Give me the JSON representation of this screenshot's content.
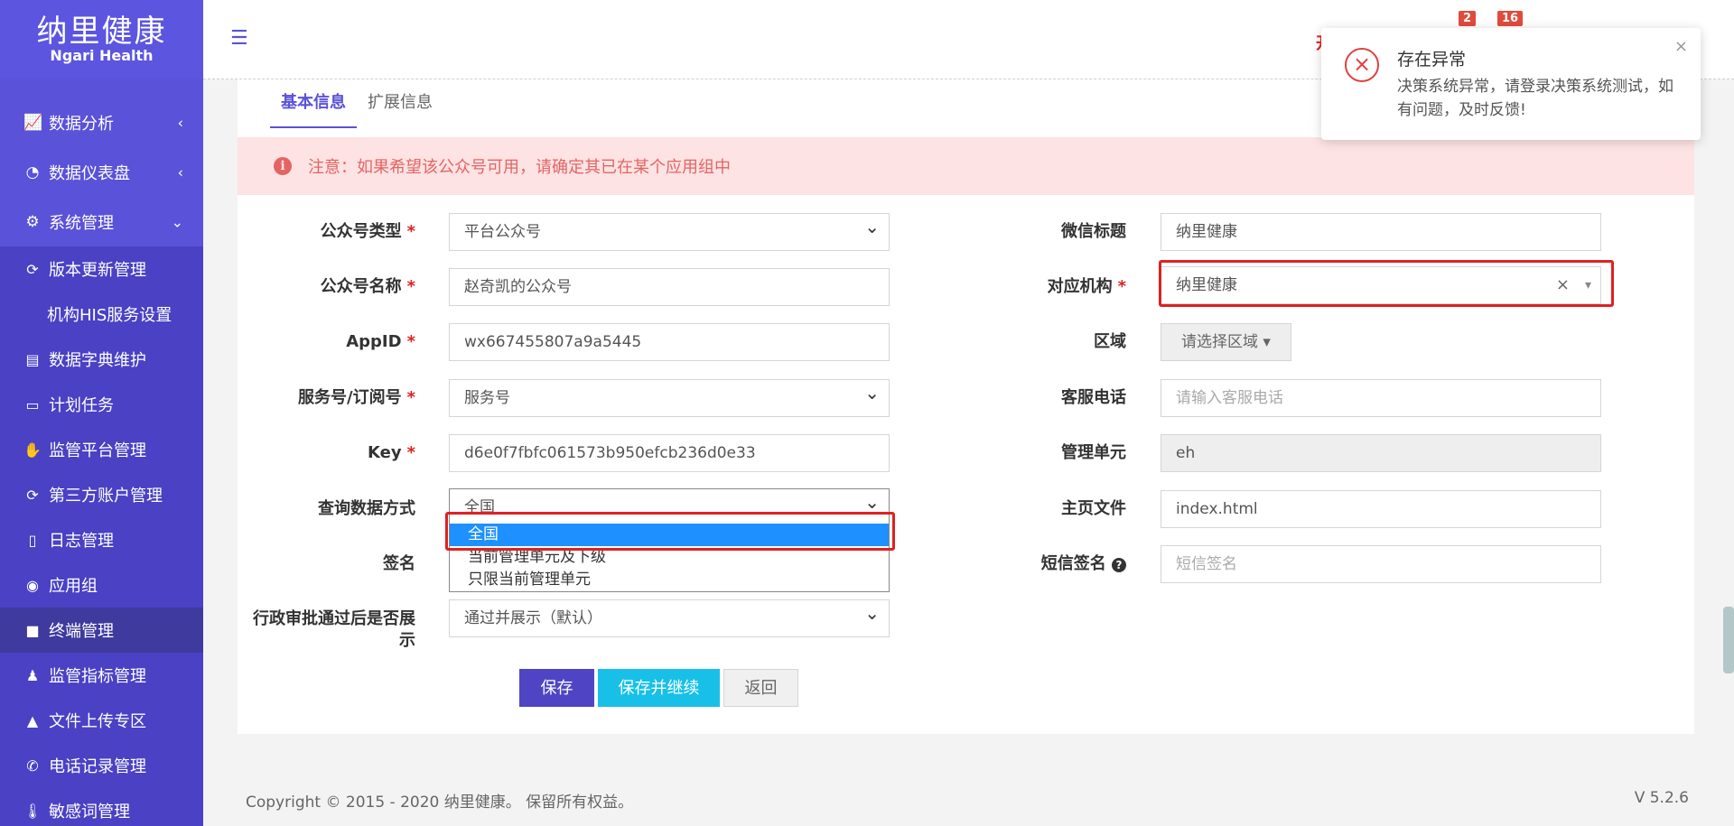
{
  "brand": {
    "cn": "纳里健康",
    "en": "Ngari Health"
  },
  "sidebar": {
    "top_items": [
      {
        "label": "数据分析",
        "icon": "area-chart-icon"
      },
      {
        "label": "数据仪表盘",
        "icon": "dashboard-icon"
      },
      {
        "label": "系统管理",
        "icon": "gear-icon"
      }
    ],
    "sub_items": [
      {
        "label": "版本更新管理",
        "icon": "refresh-icon"
      },
      {
        "label": "机构HIS服务设置",
        "icon": ""
      },
      {
        "label": "数据字典维护",
        "icon": "book-icon"
      },
      {
        "label": "计划任务",
        "icon": "monitor-icon"
      },
      {
        "label": "监管平台管理",
        "icon": "hand-icon"
      },
      {
        "label": "第三方账户管理",
        "icon": "refresh-icon"
      },
      {
        "label": "日志管理",
        "icon": "file-icon"
      },
      {
        "label": "应用组",
        "icon": "location-icon"
      },
      {
        "label": "终端管理",
        "icon": "square-icon"
      },
      {
        "label": "监管指标管理",
        "icon": "person-icon"
      },
      {
        "label": "文件上传专区",
        "icon": "road-icon"
      },
      {
        "label": "电话记录管理",
        "icon": "phone-icon"
      },
      {
        "label": "敏感词管理",
        "icon": "thermometer-icon"
      }
    ]
  },
  "topbar": {
    "badge1": "2",
    "badge2": "16",
    "cut_text": "开"
  },
  "tabs": [
    "基本信息",
    "扩展信息"
  ],
  "alert": {
    "text": "注意：如果希望该公众号可用，请确定其已在某个应用组中"
  },
  "form_left": [
    {
      "label": "公众号类型",
      "required": "*",
      "value": "平台公众号"
    },
    {
      "label": "公众号名称",
      "required": "*",
      "value": "赵奇凯的公众号"
    },
    {
      "label": "AppID",
      "required": "*",
      "value": "wx667455807a9a5445"
    },
    {
      "label": "服务号/订阅号",
      "required": "*",
      "value": "服务号"
    },
    {
      "label": "Key",
      "required": "*",
      "value": "d6e0f7fbfc061573b950efcb236d0e33"
    },
    {
      "label": "查询数据方式",
      "required": "",
      "value": "全国"
    },
    {
      "label": "签名",
      "required": "",
      "value": ""
    },
    {
      "label": "行政审批通过后是否展示",
      "required": "",
      "value": "通过并展示（默认）"
    }
  ],
  "dropdown_options": [
    "全国",
    "当前管理单元及下级",
    "只限当前管理单元"
  ],
  "form_right": [
    {
      "label": "微信标题",
      "required": "",
      "value": "纳里健康",
      "placeholder": ""
    },
    {
      "label": "对应机构",
      "required": "*",
      "value": "纳里健康",
      "placeholder": ""
    },
    {
      "label": "区域",
      "required": "",
      "value": "请选择区域 ▾",
      "placeholder": ""
    },
    {
      "label": "客服电话",
      "required": "",
      "value": "",
      "placeholder": "请输入客服电话"
    },
    {
      "label": "管理单元",
      "required": "",
      "value": "eh",
      "placeholder": ""
    },
    {
      "label": "主页文件",
      "required": "",
      "value": "index.html",
      "placeholder": ""
    },
    {
      "label": "短信签名",
      "required": "",
      "value": "",
      "placeholder": "短信签名"
    }
  ],
  "clear_mark": "×",
  "caret_mark": "▾",
  "buttons": {
    "save": "保存",
    "save_continue": "保存并继续",
    "back": "返回"
  },
  "footer": {
    "copyright": "Copyright © 2015 - 2020 纳里健康。 保留所有权益。",
    "version": "V 5.2.6"
  },
  "toast": {
    "title": "存在异常",
    "message": "决策系统异常，请登录决策系统测试，如有问题，及时反馈!"
  },
  "colors": {
    "sidebar": "#5a52d8",
    "accent": "#4f45c4",
    "danger": "#e02020",
    "info": "#18c0e8"
  }
}
